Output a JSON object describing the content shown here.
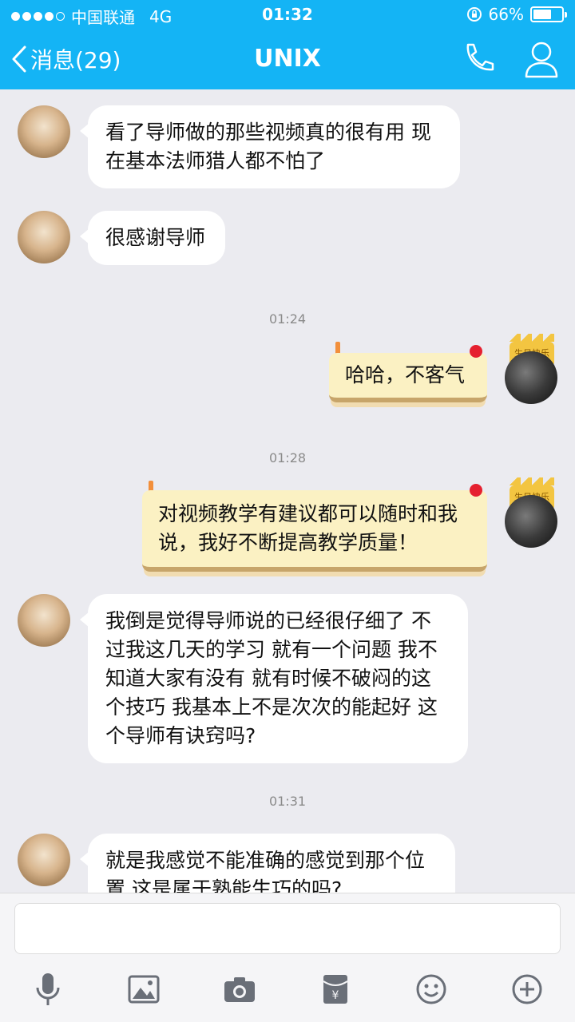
{
  "status_bar": {
    "carrier": "中国联通",
    "network": "4G",
    "time": "01:32",
    "battery": "66%",
    "battery_level": 0.66
  },
  "header": {
    "back_label": "消息(29)",
    "title": "UNIX",
    "icons": [
      "phone-icon",
      "profile-icon"
    ]
  },
  "messages": [
    {
      "side": "left",
      "text_lines": [
        "看了导师做的那些视频真的很有用 现",
        "在基本法师猎人都不怕了"
      ]
    },
    {
      "side": "left",
      "text_lines": [
        "很感谢导师"
      ]
    },
    {
      "type": "time",
      "text": "01:24"
    },
    {
      "side": "right",
      "text_lines": [
        "哈哈，不客气"
      ],
      "badge": "生日快乐"
    },
    {
      "type": "time",
      "text": "01:28"
    },
    {
      "side": "right",
      "text_lines": [
        "对视频教学有建议都可以随时和我",
        "说，我好不断提高教学质量！"
      ],
      "badge": "生日快乐"
    },
    {
      "side": "left",
      "text_lines": [
        "我倒是觉得导师说的已经很仔细了 不",
        "过我这几天的学习 就有一个问题 我不",
        "知道大家有没有 就有时候不破闷的这",
        "个技巧 我基本上不是次次的能起好 这",
        "个导师有诀窍吗?"
      ]
    },
    {
      "type": "time",
      "text": "01:31"
    },
    {
      "side": "left",
      "text_lines": [
        "就是我感觉不能准确的感觉到那个位",
        "置 这是属于熟能生巧的吗?"
      ]
    }
  ],
  "input": {
    "value": "",
    "placeholder": ""
  },
  "toolbar": [
    "microphone-icon",
    "image-icon",
    "camera-icon",
    "red-packet-icon",
    "emoji-icon",
    "plus-icon"
  ],
  "colors": {
    "header": "#14b4f5",
    "background": "#ebebf0",
    "bubble_left": "#ffffff",
    "bubble_right": "#fbf1c3"
  }
}
